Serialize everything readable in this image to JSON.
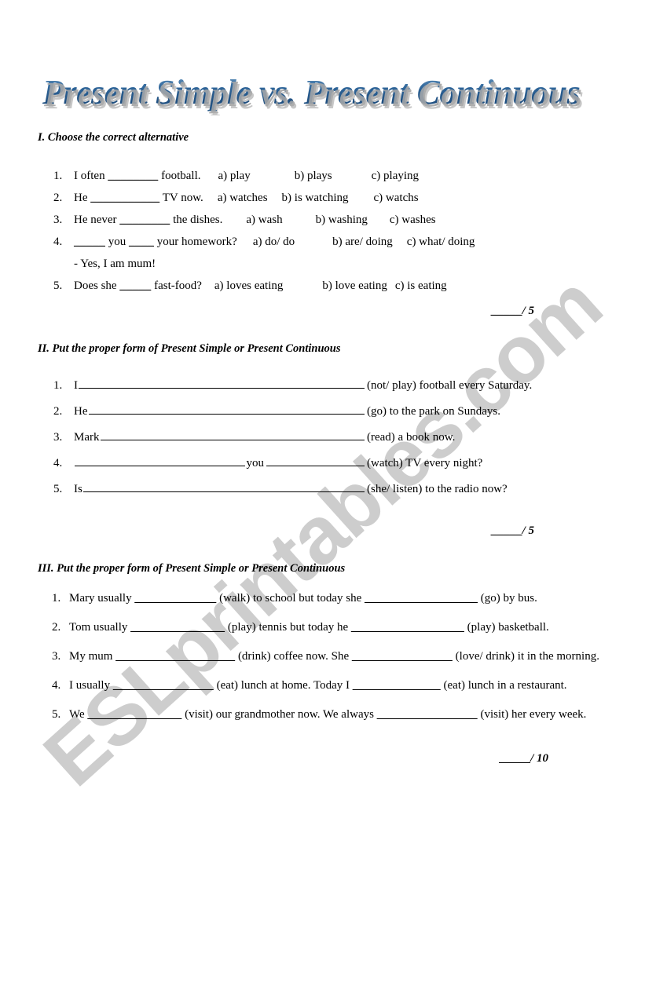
{
  "document": {
    "title": "Present Simple vs. Present Continuous",
    "watermark": "ESLprintables.com",
    "title_color": "#2d5f91",
    "watermark_color": "#c9c9c9"
  },
  "section1": {
    "heading": "I. Choose the correct alternative",
    "items": [
      {
        "num": "1.",
        "lead": "I often ",
        "blank": "________",
        "tail": " football.",
        "options": [
          "a) play",
          "b) plays",
          "c) playing"
        ]
      },
      {
        "num": "2.",
        "lead": "He ",
        "blank": "___________",
        "tail": " TV now.",
        "options": [
          "a) watches",
          "b) is watching",
          "c) watchs"
        ]
      },
      {
        "num": "3.",
        "lead": "He never ",
        "blank": "________",
        "tail": " the dishes.",
        "options": [
          "a) wash",
          "b) washing",
          "c) washes"
        ]
      },
      {
        "num": "4.",
        "lead": "",
        "blank": "_____",
        "mid": " you ",
        "blank2": "____",
        "tail": " your homework?",
        "options": [
          "a) do/ do",
          "b) are/ doing",
          "c) what/ doing"
        ],
        "subline": "- Yes, I am mum!"
      },
      {
        "num": "5.",
        "lead": "Does she ",
        "blank": "_____",
        "tail": " fast-food?",
        "options": [
          "a) loves eating",
          "b) love eating",
          "c) is eating"
        ]
      }
    ],
    "score": "/ 5",
    "score_blank": "_____"
  },
  "section2": {
    "heading": "II. Put the proper form of Present Simple or Present Continuous",
    "items": [
      {
        "num": "1.",
        "lead": "I",
        "hint": "(not/ play) football every Saturday."
      },
      {
        "num": "2.",
        "lead": "He",
        "hint": "(go) to the park on Sundays."
      },
      {
        "num": "3.",
        "lead": "Mark",
        "hint": "(read) a book now."
      },
      {
        "num": "4.",
        "lead": "",
        "mid": "you",
        "hint": "(watch) TV every night?"
      },
      {
        "num": "5.",
        "lead": "Is",
        "hint": "(she/ listen) to the radio now?"
      }
    ],
    "score": "/ 5",
    "score_blank": "_____"
  },
  "section3": {
    "heading": "III. Put the proper form of Present Simple or Present Continuous",
    "items": [
      {
        "num": "1.",
        "parts": [
          "Mary usually ",
          "_____________",
          " (walk) to school but today she ",
          "__________________",
          " (go) by bus."
        ]
      },
      {
        "num": "2.",
        "parts": [
          "Tom usually ",
          "_______________",
          " (play) tennis but today he ",
          "__________________",
          " (play) basketball."
        ]
      },
      {
        "num": "3.",
        "parts": [
          "My mum ",
          "___________________",
          " (drink) coffee now. She ",
          "________________",
          " (love/ drink) it in the morning."
        ]
      },
      {
        "num": "4.",
        "parts": [
          "I usually ",
          "________________",
          " (eat) lunch at home. Today I ",
          "______________",
          " (eat) lunch in a restaurant."
        ]
      },
      {
        "num": "5.",
        "parts": [
          "We ",
          "_______________",
          " (visit) our grandmother now. We always ",
          "________________",
          " (visit) her every week."
        ]
      }
    ],
    "score": "/ 10",
    "score_blank": "_____"
  }
}
